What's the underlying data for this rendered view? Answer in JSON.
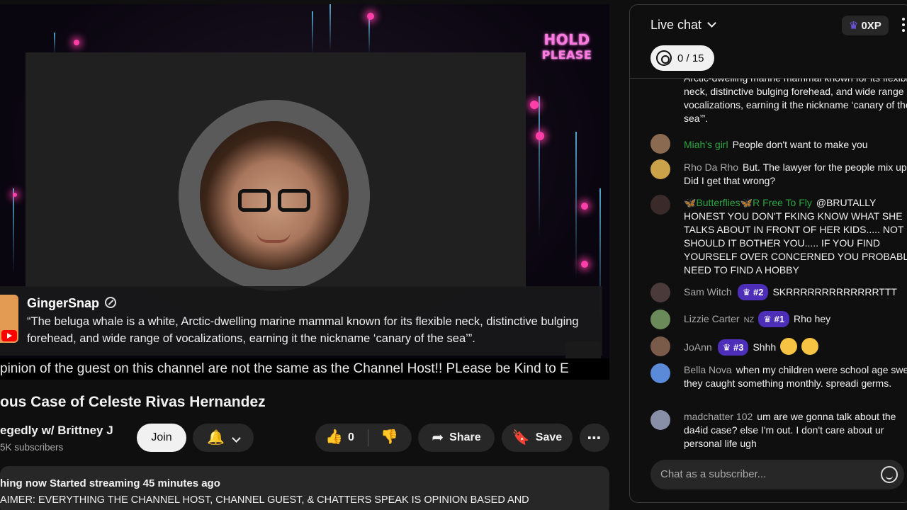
{
  "video": {
    "overlay_badge_line1": "HOLD",
    "overlay_badge_line2": "PLEASE",
    "caption_author": "GingerSnap",
    "caption_text": "“The beluga whale is a white, Arctic-dwelling marine mammal known for its flexible neck, distinctive bulging forehead, and wide range of vocalizations, earning it the nickname ‘canary of the sea’”.",
    "ticker": "pinion of the guest on this channel are not the same as the Channel Host!! PLease be Kind to E"
  },
  "title": "ous Case of Celeste Rivas Hernandez",
  "channel": {
    "name": "egedly w/ Brittney J",
    "subscribers": "5K subscribers",
    "join_label": "Join"
  },
  "actions": {
    "like_count": "0",
    "share_label": "Share",
    "save_label": "Save"
  },
  "description": {
    "meta": "hing now  Started streaming 45 minutes ago",
    "body": "AIMER: EVERYTHING THE CHANNEL HOST, CHANNEL GUEST, & CHATTERS SPEAK IS OPINION BASED AND"
  },
  "chat": {
    "title": "Live chat",
    "xp": "0XP",
    "goal": "0 / 15",
    "input_placeholder": "Chat as a subscriber...",
    "messages": [
      {
        "author": "",
        "text": "Arctic-dwelling marine mammal known for its flexible neck, distinctive bulging forehead, and wide range of vocalizations, earning it the nickname ‘canary of the sea’”."
      },
      {
        "author": "Miah's girl",
        "text": "People don't want to make you"
      },
      {
        "author": "Rho Da Rho",
        "text": "But. The lawyer for the people mix up? Did I get that wrong?"
      },
      {
        "author": "🦋Butterflies🦋R Free To Fly",
        "text": "@BRUTALLY HONEST YOU DON'T FKING KNOW WHAT SHE TALKS ABOUT IN FRONT OF HER KIDS..... NOT SHOULD IT BOTHER YOU..... IF YOU FIND YOURSELF OVER CONCERNED YOU PROBABLY NEED TO FIND A HOBBY"
      },
      {
        "author": "Sam Witch",
        "badge": "#2",
        "text": "SKRRRRRRRRRRRRRTTT"
      },
      {
        "author": "Lizzie Carter",
        "flag": "NZ",
        "badge": "#1",
        "text": "Rho hey"
      },
      {
        "author": "JoAnn",
        "badge": "#3",
        "text": "Shhh"
      },
      {
        "author": "Bella Nova",
        "text": "when my children were school age swear they caught something monthly. spreadi germs."
      },
      {
        "author": "madchatter 102",
        "text": "um are we gonna talk about the da4id case? else I'm out. I don't care about ur personal life ugh"
      }
    ]
  },
  "colors": {
    "background": "#0f0f0f",
    "member_name": "#2ba640",
    "badge_purple": "#4d2eb8",
    "neon_pink": "#ff3fa8"
  }
}
